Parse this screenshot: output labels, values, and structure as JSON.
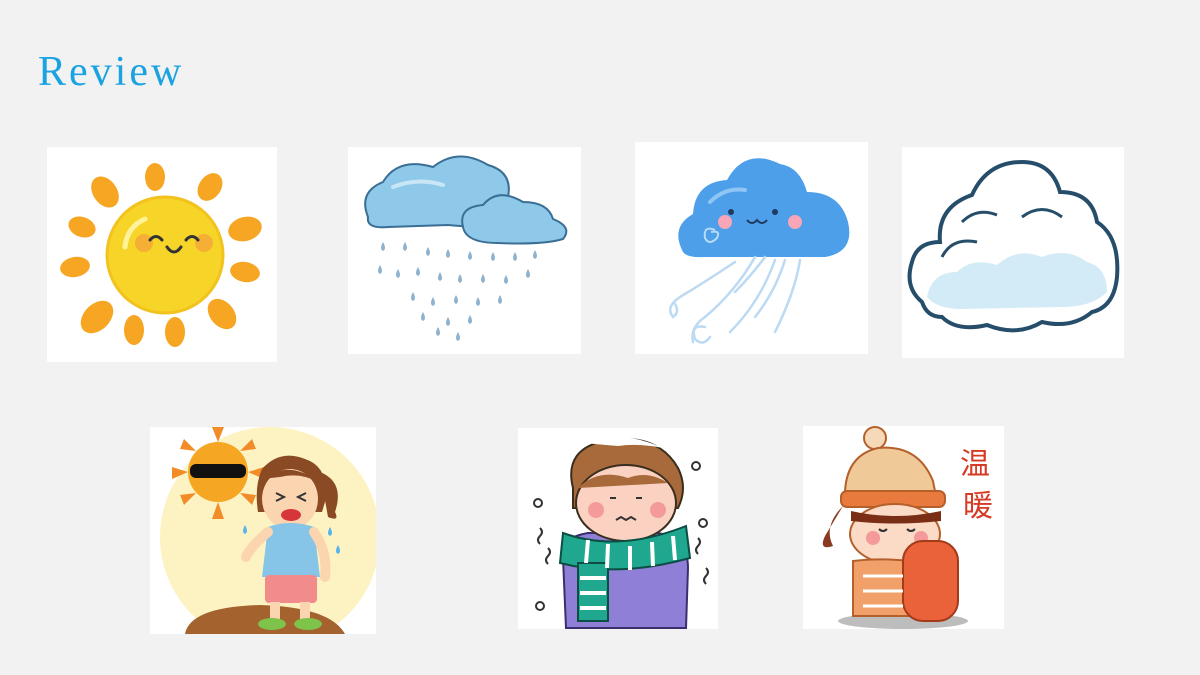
{
  "slide": {
    "title": "Review"
  },
  "images": [
    {
      "icon": "sun-icon"
    },
    {
      "icon": "rain-cloud-icon"
    },
    {
      "icon": "windy-cloud-icon"
    },
    {
      "icon": "cloud-icon"
    },
    {
      "icon": "hot-girl-sun-icon"
    },
    {
      "icon": "cold-boy-scarf-icon"
    },
    {
      "icon": "warm-girl-hot-water-bottle-icon",
      "text": "温暖"
    }
  ],
  "colors": {
    "title": "#1aa3e0",
    "background": "#f2f2f2"
  }
}
